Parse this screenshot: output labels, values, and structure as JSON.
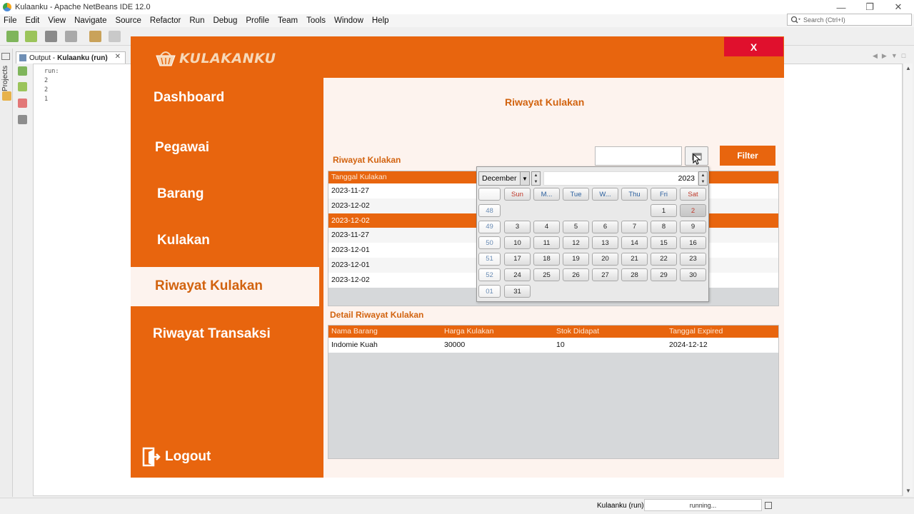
{
  "ide": {
    "window_title": "Kulaanku - Apache NetBeans IDE 12.0",
    "menu": [
      "File",
      "Edit",
      "View",
      "Navigate",
      "Source",
      "Refactor",
      "Run",
      "Debug",
      "Profile",
      "Team",
      "Tools",
      "Window",
      "Help"
    ],
    "search_placeholder": "Search (Ctrl+I)",
    "projects_label": "Projects",
    "output_tab": {
      "prefix": "Output - ",
      "name": "Kulaanku (run)"
    },
    "output_lines": [
      "run:",
      "2",
      "2",
      "1"
    ],
    "status": {
      "task": "Kulaanku (run)",
      "progress": "running..."
    }
  },
  "app": {
    "close_label": "X",
    "brand": "KULAKANKU",
    "nav": [
      "Dashboard",
      "Pegawai",
      "Barang",
      "Kulakan",
      "Riwayat Kulakan",
      "Riwayat Transaksi"
    ],
    "active_nav": "Riwayat Kulakan",
    "logout": "Logout",
    "page_title": "Riwayat Kulakan",
    "section_history": "Riwayat Kulakan",
    "date_value": "",
    "filter_label": "Filter",
    "history_table": {
      "columns": [
        "Tanggal Kulakan"
      ],
      "rows": [
        "2023-11-27",
        "2023-12-02",
        "2023-12-02",
        "2023-11-27",
        "2023-12-01",
        "2023-12-01",
        "2023-12-02"
      ],
      "selected_index": 2
    },
    "section_detail": "Detail Riwayat Kulakan",
    "detail_table": {
      "columns": [
        "Nama Barang",
        "Harga Kulakan",
        "Stok Didapat",
        "Tanggal Expired"
      ],
      "rows": [
        [
          "Indomie Kuah",
          "30000",
          "10",
          "2024-12-12"
        ]
      ]
    },
    "colors": {
      "orange": "#e8650e",
      "cream": "#fdf3ee",
      "close_red": "#e0102d",
      "title_orange": "#d2630f"
    }
  },
  "calendar": {
    "month": "December",
    "year": "2023",
    "days_of_week": [
      "Sun",
      "M...",
      "Tue",
      "W...",
      "Thu",
      "Fri",
      "Sat"
    ],
    "weeks": [
      {
        "week": "48",
        "days": [
          "",
          "",
          "",
          "",
          "",
          "1",
          "2"
        ]
      },
      {
        "week": "49",
        "days": [
          "3",
          "4",
          "5",
          "6",
          "7",
          "8",
          "9"
        ]
      },
      {
        "week": "50",
        "days": [
          "10",
          "11",
          "12",
          "13",
          "14",
          "15",
          "16"
        ]
      },
      {
        "week": "51",
        "days": [
          "17",
          "18",
          "19",
          "20",
          "21",
          "22",
          "23"
        ]
      },
      {
        "week": "52",
        "days": [
          "24",
          "25",
          "26",
          "27",
          "28",
          "29",
          "30"
        ]
      },
      {
        "week": "01",
        "days": [
          "31",
          "",
          "",
          "",
          "",
          "",
          ""
        ]
      }
    ],
    "selected_day": "2"
  }
}
